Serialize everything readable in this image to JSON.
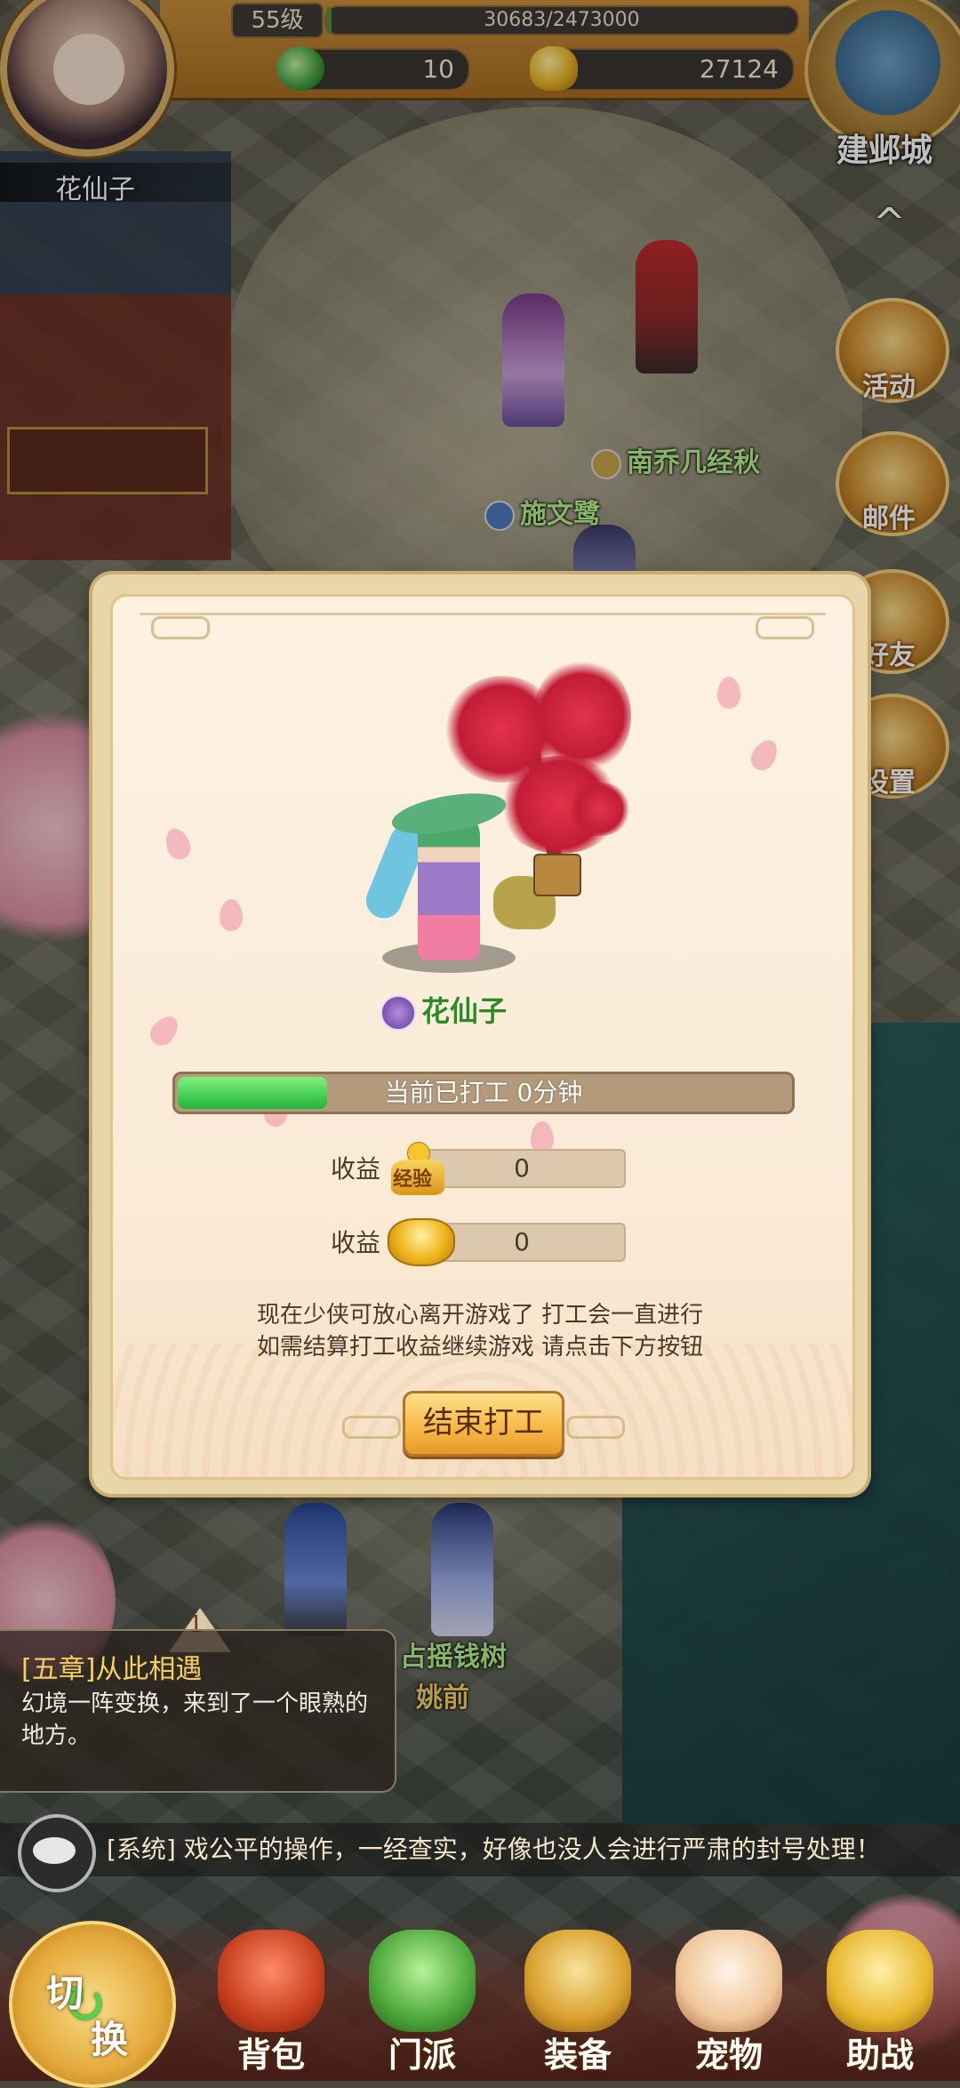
{
  "hud": {
    "player_name": "花仙子",
    "level": "55级",
    "exp": "30683/2473000",
    "exp_progress": 0.012,
    "jade": "10",
    "gold": "27124",
    "city_button": "建邺城"
  },
  "side_menu": [
    {
      "label": "活动",
      "icon": "gift-icon"
    },
    {
      "label": "邮件",
      "icon": "mail-icon"
    },
    {
      "label": "好友",
      "icon": "friends-icon"
    },
    {
      "label": "设置",
      "icon": "gear-icon"
    }
  ],
  "npcs": {
    "name_1": "南乔几经秋",
    "name_2": "施文鹭",
    "name_3": "占摇钱树",
    "name_4": "姚前"
  },
  "work_dialog": {
    "character_name": "花仙子",
    "progress_text": "当前已打工 0分钟",
    "progress": 0.25,
    "exp_label": "收益",
    "exp_icon_text": "经验",
    "exp_value": "0",
    "gold_label": "收益",
    "gold_value": "0",
    "hint_line_1": "现在少侠可放心离开游戏了 打工会一直进行",
    "hint_line_2": "如需结算打工收益继续游戏 请点击下方按钮",
    "end_button": "结束打工"
  },
  "quest": {
    "tab_number": "1",
    "title": "[五章]从此相遇",
    "description": "幻境一阵变换，来到了一个眼熟的地方。"
  },
  "chat": {
    "message": "[系统] 戏公平的操作，一经查实，好像也没人会进行严肃的封号处理！"
  },
  "bottom_nav": {
    "switch_a": "切",
    "switch_b": "换",
    "items": [
      {
        "label": "背包",
        "icon": "bag-icon"
      },
      {
        "label": "门派",
        "icon": "sect-icon"
      },
      {
        "label": "装备",
        "icon": "equipment-icon"
      },
      {
        "label": "宠物",
        "icon": "pet-icon"
      },
      {
        "label": "助战",
        "icon": "assist-icon"
      }
    ]
  },
  "colors": {
    "accent_gold": "#f6b743",
    "progress_green": "#22b33c",
    "name_green": "#2e8b1e",
    "quest_title": "#f4cf5e"
  }
}
